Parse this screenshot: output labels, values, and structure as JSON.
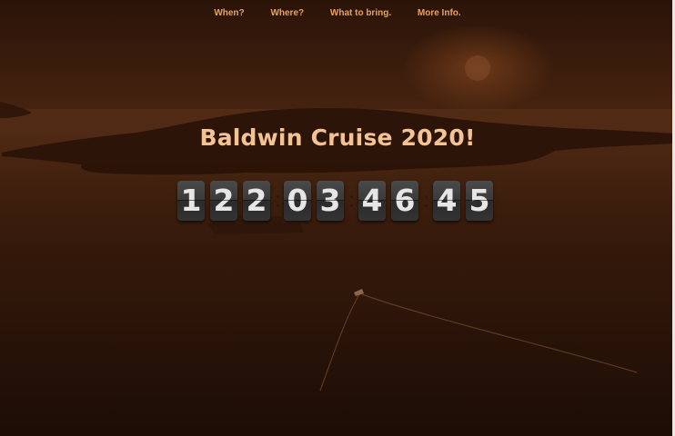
{
  "nav": {
    "items": [
      {
        "label": "When?"
      },
      {
        "label": "Where?"
      },
      {
        "label": "What to bring."
      },
      {
        "label": "More Info."
      }
    ]
  },
  "hero": {
    "title": "Baldwin Cruise 2020!"
  },
  "countdown": {
    "days": [
      "1",
      "2",
      "2"
    ],
    "hours": [
      "0",
      "3"
    ],
    "minutes": [
      "4",
      "6"
    ],
    "seconds": [
      "4",
      "5"
    ]
  },
  "colors": {
    "nav_link": "#e8a062",
    "title": "#f3c393",
    "digit_bg": "#3a3a3a",
    "digit_text": "#e6e6e6"
  }
}
